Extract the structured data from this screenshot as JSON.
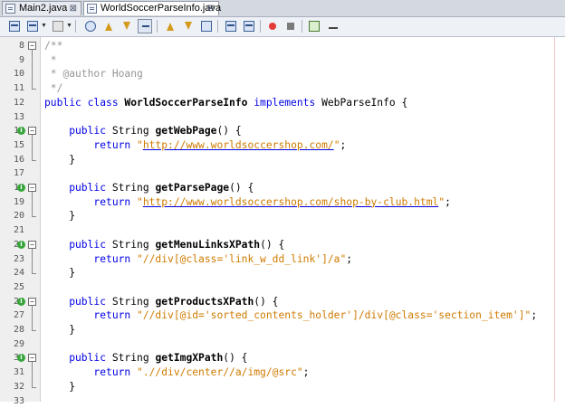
{
  "tabs": [
    {
      "label": "Main2.java",
      "close": "⊠",
      "active": false
    },
    {
      "label": "WorldSoccerParseInfo.java",
      "close": "⊠",
      "active": true
    }
  ],
  "toolbar": {
    "icons": [
      "last-edit-icon",
      "back-icon",
      "forward-icon",
      "find-icon",
      "find-prev-icon",
      "find-next-icon",
      "toggle-highlight-icon",
      "prev-bookmark-icon",
      "next-bookmark-icon",
      "toggle-bookmark-icon",
      "shift-left-icon",
      "shift-right-icon",
      "record-macro-icon",
      "stop-macro-icon",
      "comment-icon",
      "uncomment-icon"
    ]
  },
  "editor": {
    "lines": [
      {
        "num": "8",
        "fold": "−",
        "segments": [
          {
            "t": "/**",
            "c": "cm"
          }
        ]
      },
      {
        "num": "9",
        "segments": [
          {
            "t": " *",
            "c": "cm"
          }
        ]
      },
      {
        "num": "10",
        "segments": [
          {
            "t": " * @author Hoang",
            "c": "cm"
          }
        ]
      },
      {
        "num": "11",
        "segments": [
          {
            "t": " */",
            "c": "cm"
          }
        ]
      },
      {
        "num": "12",
        "segments": [
          {
            "t": "public class ",
            "c": "kw"
          },
          {
            "t": "WorldSoccerParseInfo",
            "c": "bold"
          },
          {
            "t": " implements ",
            "c": "kw"
          },
          {
            "t": "WebParseInfo {",
            "c": ""
          }
        ]
      },
      {
        "num": "13",
        "segments": []
      },
      {
        "num": "14",
        "fold": "−",
        "override": "i",
        "segments": [
          {
            "t": "    public ",
            "c": "kw"
          },
          {
            "t": "String ",
            "c": ""
          },
          {
            "t": "getWebPage",
            "c": "bold"
          },
          {
            "t": "() {",
            "c": ""
          }
        ]
      },
      {
        "num": "15",
        "segments": [
          {
            "t": "        return ",
            "c": "kw"
          },
          {
            "t": "\"",
            "c": "str"
          },
          {
            "t": "http://www.worldsoccershop.com/",
            "c": "url"
          },
          {
            "t": "\"",
            "c": "str"
          },
          {
            "t": ";",
            "c": ""
          }
        ]
      },
      {
        "num": "16",
        "segments": [
          {
            "t": "    }",
            "c": ""
          }
        ]
      },
      {
        "num": "17",
        "segments": []
      },
      {
        "num": "18",
        "fold": "−",
        "override": "i",
        "segments": [
          {
            "t": "    public ",
            "c": "kw"
          },
          {
            "t": "String ",
            "c": ""
          },
          {
            "t": "getParsePage",
            "c": "bold"
          },
          {
            "t": "() {",
            "c": ""
          }
        ]
      },
      {
        "num": "19",
        "segments": [
          {
            "t": "        return ",
            "c": "kw"
          },
          {
            "t": "\"",
            "c": "str"
          },
          {
            "t": "http://www.worldsoccershop.com/shop-by-club.html",
            "c": "url"
          },
          {
            "t": "\"",
            "c": "str"
          },
          {
            "t": ";",
            "c": ""
          }
        ]
      },
      {
        "num": "20",
        "segments": [
          {
            "t": "    }",
            "c": ""
          }
        ]
      },
      {
        "num": "21",
        "segments": []
      },
      {
        "num": "22",
        "fold": "−",
        "override": "i",
        "segments": [
          {
            "t": "    public ",
            "c": "kw"
          },
          {
            "t": "String ",
            "c": ""
          },
          {
            "t": "getMenuLinksXPath",
            "c": "bold"
          },
          {
            "t": "() {",
            "c": ""
          }
        ]
      },
      {
        "num": "23",
        "segments": [
          {
            "t": "        return ",
            "c": "kw"
          },
          {
            "t": "\"//div[@class='link_w_dd_link']/a\"",
            "c": "str"
          },
          {
            "t": ";",
            "c": ""
          }
        ]
      },
      {
        "num": "24",
        "segments": [
          {
            "t": "    }",
            "c": ""
          }
        ]
      },
      {
        "num": "25",
        "segments": []
      },
      {
        "num": "26",
        "fold": "−",
        "override": "i",
        "segments": [
          {
            "t": "    public ",
            "c": "kw"
          },
          {
            "t": "String ",
            "c": ""
          },
          {
            "t": "getProductsXPath",
            "c": "bold"
          },
          {
            "t": "() {",
            "c": ""
          }
        ]
      },
      {
        "num": "27",
        "segments": [
          {
            "t": "        return ",
            "c": "kw"
          },
          {
            "t": "\"//div[@id='sorted_contents_holder']/div[@class='section_item']\"",
            "c": "str"
          },
          {
            "t": ";",
            "c": ""
          }
        ]
      },
      {
        "num": "28",
        "segments": [
          {
            "t": "    }",
            "c": ""
          }
        ]
      },
      {
        "num": "29",
        "segments": []
      },
      {
        "num": "30",
        "fold": "−",
        "override": "i",
        "segments": [
          {
            "t": "    public ",
            "c": "kw"
          },
          {
            "t": "String ",
            "c": ""
          },
          {
            "t": "getImgXPath",
            "c": "bold"
          },
          {
            "t": "() {",
            "c": ""
          }
        ]
      },
      {
        "num": "31",
        "segments": [
          {
            "t": "        return ",
            "c": "kw"
          },
          {
            "t": "\".//div/center//a/img/@src\"",
            "c": "str"
          },
          {
            "t": ";",
            "c": ""
          }
        ]
      },
      {
        "num": "32",
        "segments": [
          {
            "t": "    }",
            "c": ""
          }
        ]
      },
      {
        "num": "33",
        "segments": []
      }
    ]
  }
}
